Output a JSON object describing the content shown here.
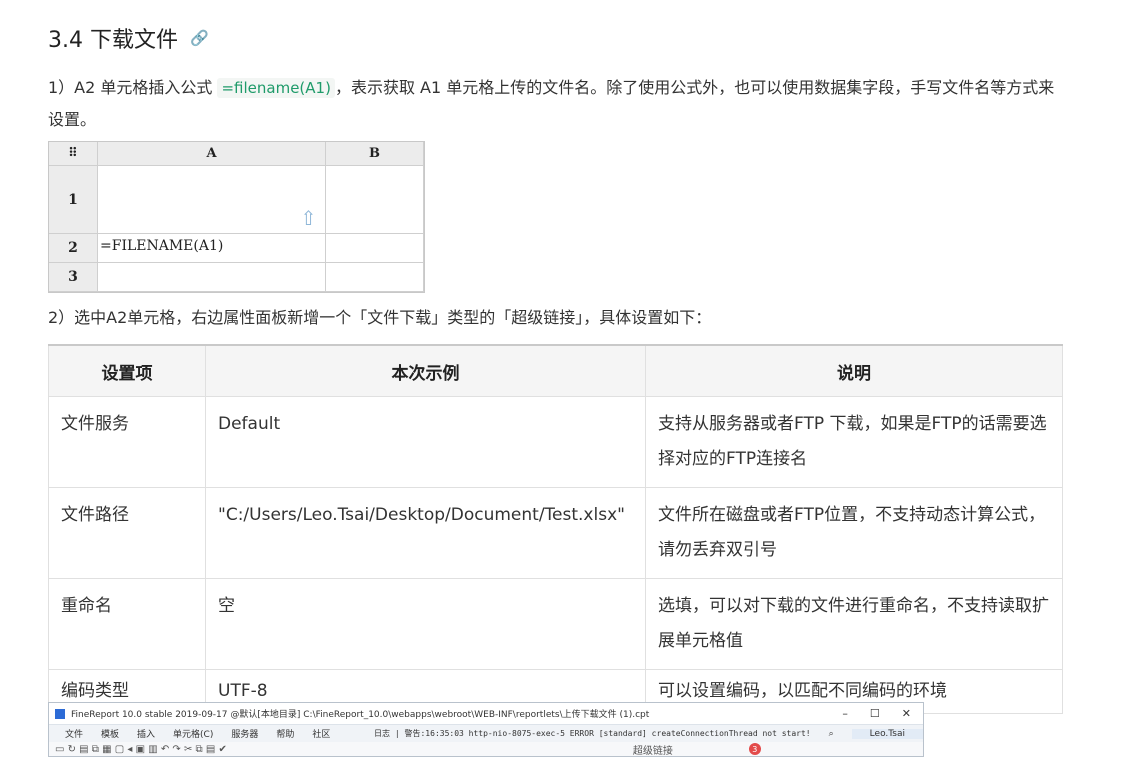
{
  "heading": {
    "title": "3.4 下载文件",
    "link_icon": "🔗"
  },
  "para1": {
    "prefix": "1）A2 单元格插入公式 ",
    "formula": "=filename(A1)",
    "suffix": "，表示获取 A1 单元格上传的文件名。除了使用公式外，也可以使用数据集字段，手写文件名等方式来设置。"
  },
  "sheet": {
    "corner": "⠿",
    "col_a": "A",
    "col_b": "B",
    "row1": "1",
    "row2": "2",
    "row3": "3",
    "a2_value": "=FILENAME(A1)",
    "upload_icon": "⇧"
  },
  "para2": {
    "text": "2）选中A2单元格，右边属性面板新增一个「文件下载」类型的「超级链接」，具体设置如下："
  },
  "table": {
    "headers": [
      "设置项",
      "本次示例",
      "说明"
    ],
    "rows": [
      [
        "文件服务",
        "Default",
        "支持从服务器或者FTP 下载，如果是FTP的话需要选择对应的FTP连接名"
      ],
      [
        "文件路径",
        "\"C:/Users/Leo.Tsai/Desktop/Document/Test.xlsx\"",
        "文件所在磁盘或者FTP位置，不支持动态计算公式，请勿丢弃双引号"
      ],
      [
        "重命名",
        "空",
        "选填，可以对下载的文件进行重命名，不支持读取扩展单元格值"
      ],
      [
        "编码类型",
        "UTF-8",
        "可以设置编码，以匹配不同编码的环境"
      ]
    ]
  },
  "window": {
    "title": "FineReport 10.0 stable 2019-09-17 @默认[本地目录]    C:\\FineReport_10.0\\webapps\\webroot\\WEB-INF\\reportlets\\上传下载文件 (1).cpt",
    "buttons": [
      "–",
      "☐",
      "✕"
    ],
    "menu": [
      "文件",
      "模板",
      "插入",
      "单元格(C)",
      "服务器",
      "帮助",
      "社区"
    ],
    "log": "日志 | 警告:16:35:03 http-nio-8075-exec-5 ERROR [standard] createConnectionThread not start!",
    "user": "Leo.Tsai",
    "toolbar_label": "超级链接",
    "badge": "3"
  }
}
